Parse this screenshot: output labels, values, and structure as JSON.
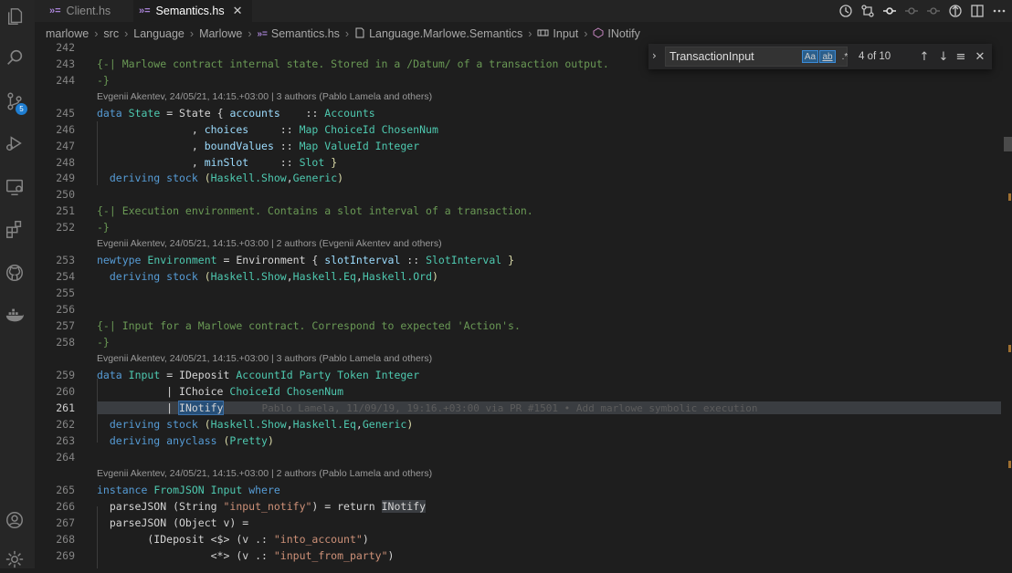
{
  "tabs": [
    {
      "label": "Client.hs",
      "icon": "haskell-icon",
      "active": false
    },
    {
      "label": "Semantics.hs",
      "icon": "haskell-icon",
      "active": true,
      "close": "✕"
    }
  ],
  "breadcrumb": [
    "marlowe",
    "src",
    "Language",
    "Marlowe",
    "Semantics.hs",
    "Language.Marlowe.Semantics",
    "Input",
    "INotify"
  ],
  "activity_bar": {
    "items": [
      "explorer-icon",
      "search-icon",
      "source-control-icon",
      "run-debug-icon",
      "remote-explorer-icon",
      "extensions-icon",
      "github-icon",
      "docker-icon"
    ],
    "source_control_badge": "5",
    "bottom": [
      "account-icon",
      "settings-gear-icon"
    ]
  },
  "find": {
    "query": "TransactionInput",
    "match_case": "Aa",
    "whole_word": "ab",
    "regex": ".*",
    "count": "4 of 10"
  },
  "blame": {
    "b244": "Evgenii Akentev, 24/05/21, 14:15.+03:00 | 3 authors (Pablo Lamela and others)",
    "b252": "Evgenii Akentev, 24/05/21, 14:15.+03:00 | 2 authors (Evgenii Akentev and others)",
    "b258": "Evgenii Akentev, 24/05/21, 14:15.+03:00 | 3 authors (Pablo Lamela and others)",
    "b264": "Evgenii Akentev, 24/05/21, 14:15.+03:00 | 2 authors (Pablo Lamela and others)",
    "inline261": "Pablo Lamela, 11/09/19, 19:16.+03:00 via PR #1501 • Add marlowe symbolic execution"
  },
  "line_numbers": [
    "242",
    "243",
    "244",
    "245",
    "246",
    "247",
    "248",
    "249",
    "250",
    "251",
    "252",
    "253",
    "254",
    "255",
    "256",
    "257",
    "258",
    "259",
    "260",
    "261",
    "262",
    "263",
    "264",
    "265",
    "266",
    "267",
    "268",
    "269"
  ],
  "code": {
    "l243": "{-| Marlowe contract internal state. Stored in a /Datum/ of a transaction output.",
    "l244": "-}",
    "l245a": "data",
    "l245b": "State",
    "l245c": " = State { ",
    "l245d": "accounts",
    "l245e": "    :: ",
    "l245f": "Accounts",
    "l246a": "               , ",
    "l246b": "choices",
    "l246c": "     :: ",
    "l246d": "Map ChoiceId ChosenNum",
    "l247a": "               , ",
    "l247b": "boundValues",
    "l247c": " :: ",
    "l247d": "Map ValueId Integer",
    "l248a": "               , ",
    "l248b": "minSlot",
    "l248c": "     :: ",
    "l248d": "Slot",
    "l248e": " }",
    "l249a": "  deriving stock",
    "l249b": " (",
    "l249c": "Haskell.Show",
    "l249d": ",",
    "l249e": "Generic",
    "l249f": ")",
    "l251": "{-| Execution environment. Contains a slot interval of a transaction.",
    "l252": "-}",
    "l253a": "newtype",
    "l253b": "Environment",
    "l253c": " = Environment { ",
    "l253d": "slotInterval",
    "l253e": " :: ",
    "l253f": "SlotInterval",
    "l253g": " }",
    "l254a": "  deriving stock",
    "l254b": " (",
    "l254c": "Haskell.Show",
    "l254d": ",",
    "l254e": "Haskell.Eq",
    "l254f": ",",
    "l254g": "Haskell.Ord",
    "l254h": ")",
    "l257": "{-| Input for a Marlowe contract. Correspond to expected 'Action's.",
    "l258": "-}",
    "l259a": "data",
    "l259b": "Input",
    "l259c": " = IDeposit ",
    "l259d": "AccountId Party Token Integer",
    "l260a": "           | IChoice ",
    "l260b": "ChoiceId ChosenNum",
    "l261a": "           | ",
    "l261b": "INotify",
    "l262a": "  deriving stock",
    "l262b": " (",
    "l262c": "Haskell.Show",
    "l262d": ",",
    "l262e": "Haskell.Eq",
    "l262f": ",",
    "l262g": "Generic",
    "l262h": ")",
    "l263a": "  deriving anyclass",
    "l263b": " (",
    "l263c": "Pretty",
    "l263d": ")",
    "l265a": "instance",
    "l265b": "FromJSON Input",
    "l265c": "where",
    "l266a": "  parseJSON (String ",
    "l266b": "\"input_notify\"",
    "l266c": ") = return ",
    "l266d": "INotify",
    "l267a": "  parseJSON (Object v) =",
    "l268a": "        (IDeposit <$> (v .: ",
    "l268b": "\"into_account\"",
    "l268c": ")",
    "l269a": "                  <*> (v .: ",
    "l269b": "\"input_from_party\"",
    "l269c": ")"
  }
}
